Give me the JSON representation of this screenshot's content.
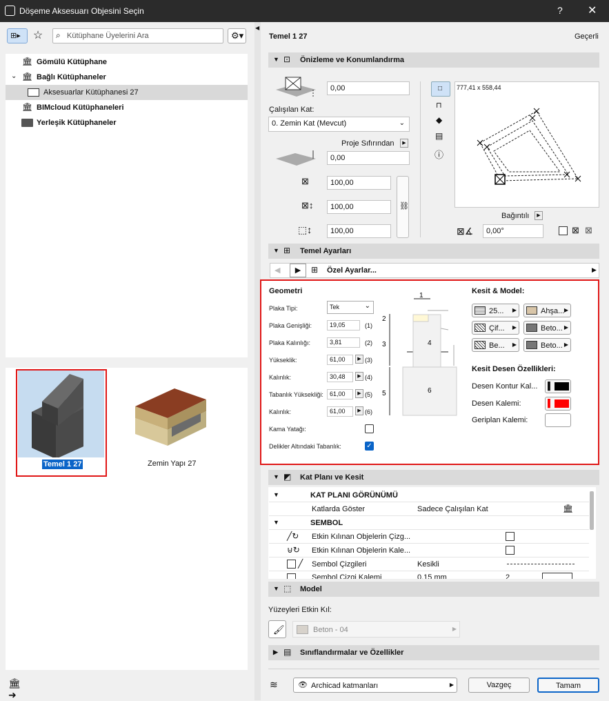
{
  "window": {
    "title": "Döşeme Aksesuarı Objesini Seçin",
    "help": "?",
    "close": "✕"
  },
  "left": {
    "search_placeholder": "Kütüphane Üyelerini Ara",
    "tree": [
      {
        "label": "Gömülü Kütüphane"
      },
      {
        "label": "Bağlı Kütüphaneler"
      },
      {
        "label": "Aksesuarlar Kütüphanesi 27"
      },
      {
        "label": "BIMcloud Kütüphaneleri"
      },
      {
        "label": "Yerleşik Kütüphaneler"
      }
    ],
    "thumbnails": [
      {
        "label": "Temel 1 27"
      },
      {
        "label": "Zemin Yapı 27"
      }
    ]
  },
  "header": {
    "title": "Temel 1 27",
    "mode": "Geçerli"
  },
  "preview": {
    "section_title": "Önizleme ve Konumlandırma",
    "elev_value": "0,00",
    "story_label": "Çalışılan Kat:",
    "story_value": "0. Zemin Kat (Mevcut)",
    "proj_zero_label": "Proje Sıfırından",
    "proj_zero_value": "0,00",
    "dim_x": "100,00",
    "dim_y": "100,00",
    "dim_z": "100,00",
    "canvas_size": "777,41 x 558,44",
    "relative_label": "Bağıntılı",
    "angle_value": "0,00°"
  },
  "settings": {
    "section_title": "Temel Ayarları",
    "custom_label": "Özel Ayarlar...",
    "geometry_title": "Geometri",
    "fields": [
      {
        "label": "Plaka Tipi:",
        "value": "Tek"
      },
      {
        "label": "Plaka Genişliği:",
        "value": "19,05",
        "num": "(1)"
      },
      {
        "label": "Plaka Kalınlığı:",
        "value": "3,81",
        "num": "(2)"
      },
      {
        "label": "Yükseklik:",
        "value": "61,00",
        "num": "(3)"
      },
      {
        "label": "Kalınlık:",
        "value": "30,48",
        "num": "(4)"
      },
      {
        "label": "Tabanlık Yüksekliği:",
        "value": "61,00",
        "num": "(5)"
      },
      {
        "label": "Kalınlık:",
        "value": "61,00",
        "num": "(6)"
      },
      {
        "label": "Kama Yatağı:"
      },
      {
        "label": "Delikler Altındaki Tabanlık:"
      }
    ],
    "diagram_labels": [
      "1",
      "2",
      "3",
      "4",
      "5",
      "6"
    ],
    "section_model_title": "Kesit & Model:",
    "fills_left": [
      "25...",
      "Çif...",
      "Be..."
    ],
    "fills_right": [
      "Ahşa...",
      "Beto...",
      "Beto..."
    ],
    "section_pattern_title": "Kesit Desen Özellikleri:",
    "contour_pen": "Desen Kontur Kal...",
    "pattern_pen": "Desen Kalemi:",
    "bg_pen": "Geriplan Kalemi:"
  },
  "floorplan": {
    "section_title": "Kat Planı ve Kesit",
    "group1": "KAT PLANI GÖRÜNÜMÜ",
    "show_on_stories": "Katlarda Göster",
    "show_on_stories_value": "Sadece Çalışılan Kat",
    "group2": "SEMBOL",
    "row_a": "Etkin Kılınan Objelerin Çizg...",
    "row_b": "Etkin Kılınan Objelerin Kale...",
    "row_c": "Sembol Çizgileri",
    "row_c_value": "Kesikli",
    "row_d": "Sembol Çizgi Kalemi",
    "row_d_value": "0,15 mm",
    "row_d_num": "2"
  },
  "model": {
    "section_title": "Model",
    "surfaces_label": "Yüzeyleri Etkin Kıl:",
    "surface_value": "Beton - 04"
  },
  "classification": {
    "section_title": "Sınıflandırmalar ve Özellikler"
  },
  "footer": {
    "layers": "Archicad katmanları",
    "cancel": "Vazgeç",
    "ok": "Tamam"
  },
  "colors": {
    "selection": "#0a64c8",
    "red": "#e01515",
    "pen_red": "#ff0000",
    "section": "#dadada"
  }
}
